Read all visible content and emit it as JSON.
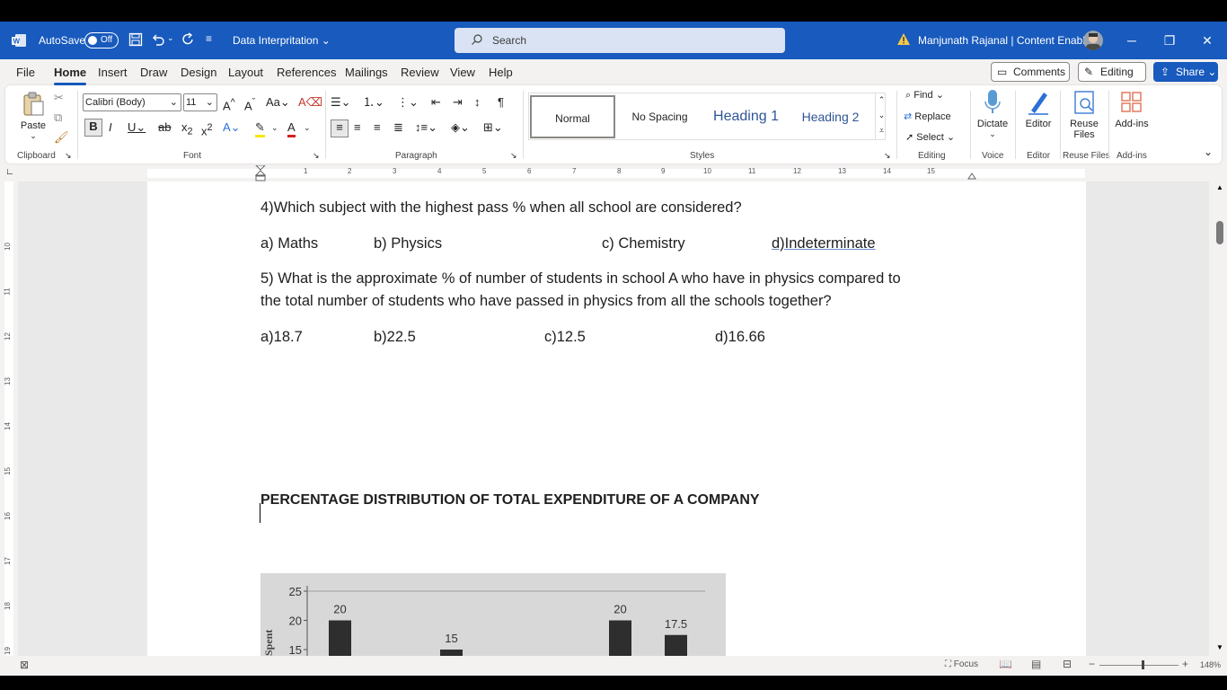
{
  "titlebar": {
    "autosave_label": "AutoSave",
    "autosave_state": "Off",
    "doc_title": "Data Interpritation",
    "search_placeholder": "Search",
    "user_name": "Manjunath Rajanal | Content Enablers",
    "brand_color": "#185abd"
  },
  "menu": {
    "tabs": [
      "File",
      "Home",
      "Insert",
      "Draw",
      "Design",
      "Layout",
      "References",
      "Mailings",
      "Review",
      "View",
      "Help"
    ],
    "active_tab": "Home",
    "comments_label": "Comments",
    "editing_label": "Editing",
    "share_label": "Share"
  },
  "ribbon": {
    "clipboard": {
      "paste_label": "Paste",
      "group_label": "Clipboard"
    },
    "font": {
      "font_name": "Calibri (Body)",
      "font_size": "11",
      "group_label": "Font"
    },
    "paragraph": {
      "group_label": "Paragraph"
    },
    "styles": {
      "items": [
        "Normal",
        "No Spacing",
        "Heading 1",
        "Heading 2"
      ],
      "selected": "Normal",
      "group_label": "Styles"
    },
    "editing": {
      "find_label": "Find",
      "replace_label": "Replace",
      "select_label": "Select",
      "group_label": "Editing"
    },
    "voice": {
      "dictate_label": "Dictate",
      "group_label": "Voice"
    },
    "editor": {
      "editor_label": "Editor",
      "group_label": "Editor"
    },
    "reuse": {
      "label_line1": "Reuse",
      "label_line2": "Files",
      "group_label": "Reuse Files"
    },
    "addins": {
      "label": "Add-ins",
      "group_label": "Add-ins"
    }
  },
  "ruler": {
    "h_numbers": [
      "1",
      "2",
      "3",
      "4",
      "5",
      "6",
      "7",
      "8",
      "9",
      "10",
      "11",
      "12",
      "13",
      "14",
      "15"
    ],
    "v_numbers": [
      "10",
      "11",
      "12",
      "13",
      "14",
      "15",
      "16",
      "17",
      "18",
      "19"
    ]
  },
  "document": {
    "q4": "4)Which subject with the highest pass % when all school are considered?",
    "q4_options": [
      "a) Maths",
      "b) Physics",
      "c) Chemistry",
      "d)Indeterminate"
    ],
    "q5_line1": "5) What is the approximate % of number of students in school A who have in physics compared to",
    "q5_line2": "the total number of students who have passed in physics from all the schools together?",
    "q5_options": [
      "a)18.7",
      "b)22.5",
      "c)12.5",
      "d)16.66"
    ],
    "heading": "PERCENTAGE DISTRIBUTION OF TOTAL EXPENDITURE OF A COMPANY"
  },
  "chart_data": {
    "type": "bar",
    "ylabel": "Spent",
    "y_ticks": [
      "25",
      "20",
      "15"
    ],
    "ylim": [
      0,
      25
    ],
    "visible_bar_labels": [
      "20",
      "15",
      "20",
      "17.5"
    ],
    "values": [
      20,
      15,
      20,
      17.5
    ]
  },
  "statusbar": {
    "focus_label": "Focus",
    "zoom_level": "148%"
  }
}
